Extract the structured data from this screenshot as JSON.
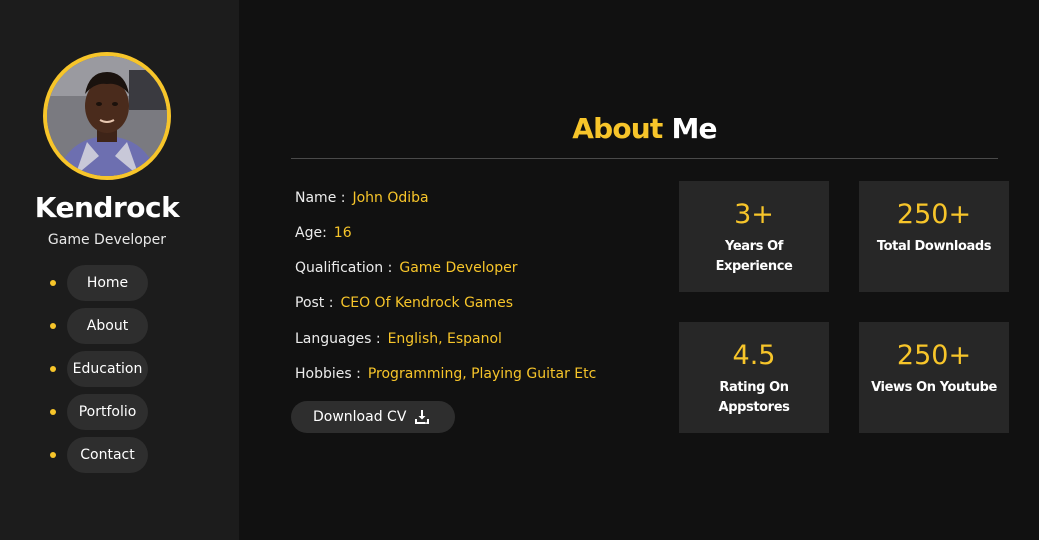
{
  "sidebar": {
    "name": "Kendrock",
    "role": "Game Developer",
    "nav": [
      {
        "label": "Home"
      },
      {
        "label": "About"
      },
      {
        "label": "Education"
      },
      {
        "label": "Portfolio"
      },
      {
        "label": "Contact"
      }
    ]
  },
  "about": {
    "title_accent": "About",
    "title_rest": " Me",
    "rows": [
      {
        "key": "Name :",
        "value": "John Odiba"
      },
      {
        "key": "Age:",
        "value": "16"
      },
      {
        "key": "Qualification :",
        "value": "Game Developer"
      },
      {
        "key": "Post :",
        "value": "CEO Of Kendrock Games"
      },
      {
        "key": "Languages :",
        "value": "English, Espanol"
      },
      {
        "key": "Hobbies :",
        "value": "Programming, Playing Guitar Etc"
      }
    ],
    "download_label": "Download CV",
    "download_icon": "download-icon"
  },
  "stats": [
    {
      "number": "3+",
      "label": "Years Of Experience"
    },
    {
      "number": "250+",
      "label": "Total Downloads"
    },
    {
      "number": "4.5",
      "label": "Rating On Appstores"
    },
    {
      "number": "250+",
      "label": "Views On Youtube"
    }
  ],
  "colors": {
    "accent": "#f7c52a",
    "background": "#111111",
    "sidebar": "#1c1c1c",
    "card": "#272727",
    "pill": "#2e2e2e"
  }
}
